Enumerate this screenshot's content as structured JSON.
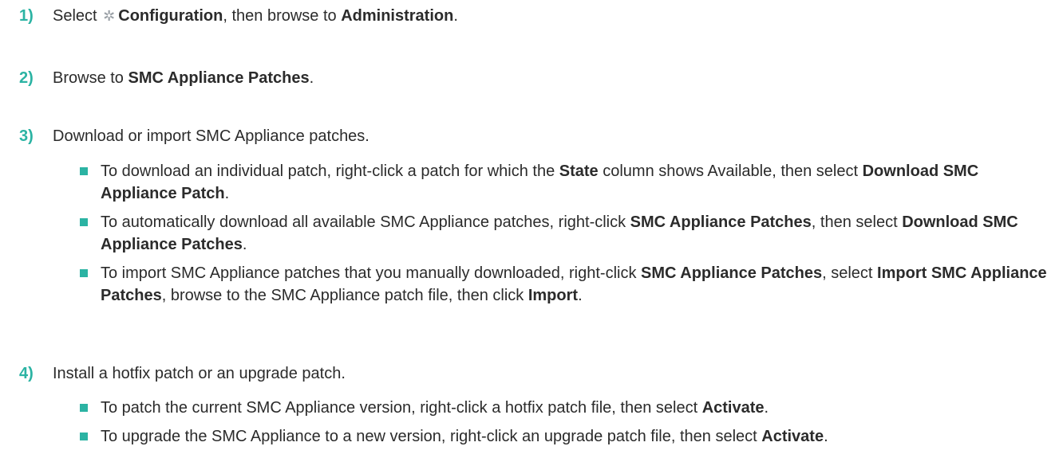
{
  "steps": [
    {
      "num": "1)",
      "parts": [
        {
          "t": "Select "
        },
        {
          "icon": "gear"
        },
        {
          "t": "Configuration",
          "b": true
        },
        {
          "t": ", then browse to "
        },
        {
          "t": "Administration",
          "b": true
        },
        {
          "t": "."
        }
      ]
    },
    {
      "num": "2)",
      "parts": [
        {
          "t": "Browse to "
        },
        {
          "t": "SMC Appliance Patches",
          "b": true
        },
        {
          "t": "."
        }
      ]
    },
    {
      "num": "3)",
      "parts": [
        {
          "t": "Download or import SMC Appliance patches."
        }
      ],
      "bullets": [
        [
          {
            "t": "To download an individual patch, right-click a patch for which the "
          },
          {
            "t": "State",
            "b": true
          },
          {
            "t": " column shows Available, then select "
          },
          {
            "t": "Download SMC Appliance Patch",
            "b": true
          },
          {
            "t": "."
          }
        ],
        [
          {
            "t": "To automatically download all available SMC Appliance patches, right-click "
          },
          {
            "t": "SMC Appliance Patches",
            "b": true
          },
          {
            "t": ", then select "
          },
          {
            "t": "Download SMC Appliance Patches",
            "b": true
          },
          {
            "t": "."
          }
        ],
        [
          {
            "t": "To import SMC Appliance patches that you manually downloaded, right-click "
          },
          {
            "t": "SMC Appliance Patches",
            "b": true
          },
          {
            "t": ", select "
          },
          {
            "t": "Import SMC Appliance Patches",
            "b": true
          },
          {
            "t": ", browse to the SMC Appliance patch file, then click "
          },
          {
            "t": "Import",
            "b": true
          },
          {
            "t": "."
          }
        ]
      ]
    },
    {
      "num": "4)",
      "parts": [
        {
          "t": "Install a hotfix patch or an upgrade patch."
        }
      ],
      "bullets": [
        [
          {
            "t": "To patch the current SMC Appliance version, right-click a hotfix patch file, then select "
          },
          {
            "t": "Activate",
            "b": true
          },
          {
            "t": "."
          }
        ],
        [
          {
            "t": "To upgrade the SMC Appliance to a new version, right-click an upgrade patch file, then select "
          },
          {
            "t": "Activate",
            "b": true
          },
          {
            "t": "."
          }
        ]
      ]
    }
  ],
  "colors": {
    "accent": "#2bb3a3",
    "text": "#2b2b2b",
    "icon": "#9aa0a6"
  }
}
